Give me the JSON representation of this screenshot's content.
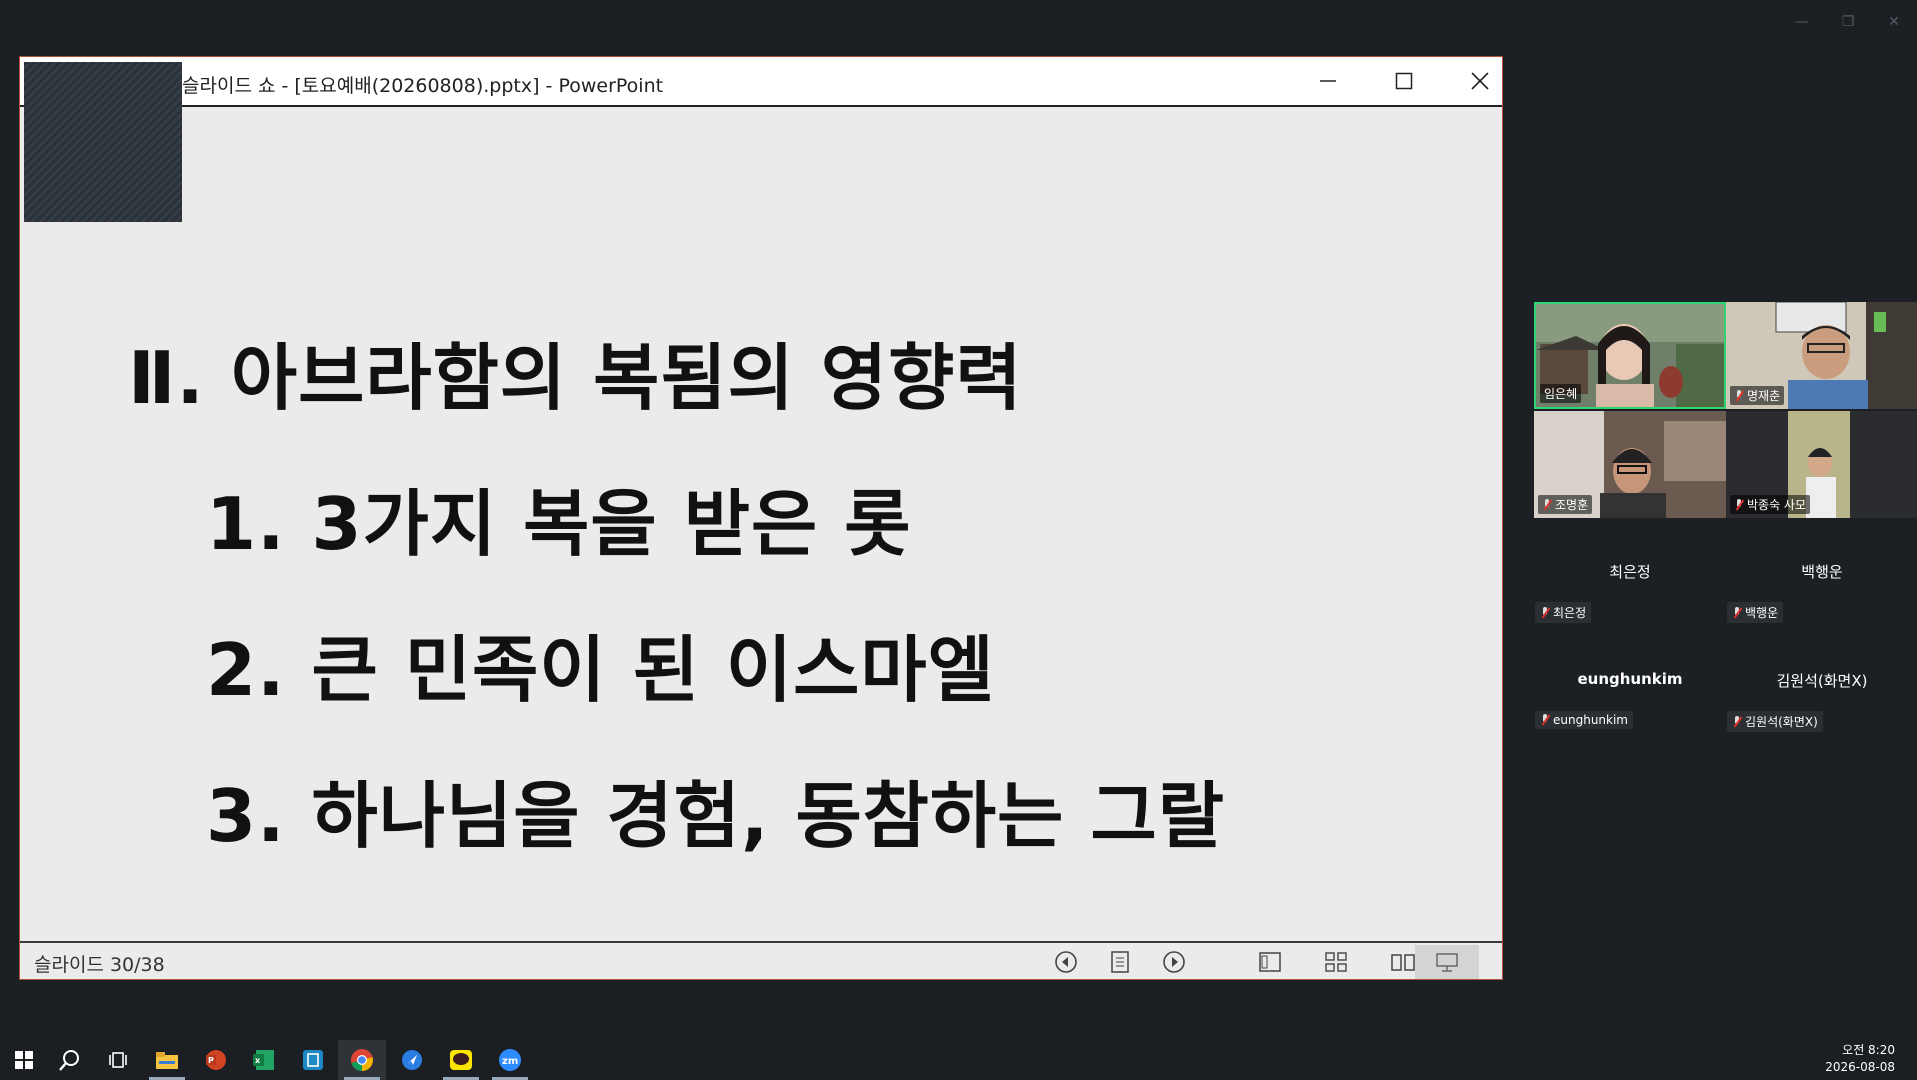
{
  "zoom_window": {
    "controls": [
      "minimize-icon",
      "restore-icon",
      "close-icon"
    ]
  },
  "ppt": {
    "title": "슬라이드 쇼 - [토요예배(20260808).pptx] - PowerPoint",
    "slide": {
      "heading": "Ⅱ. 아브라함의 복됨의 영향력",
      "items": [
        "1. 3가지 복을 받은 롯",
        "2. 큰 민족이 된 이스마엘",
        "3. 하나님을 경험, 동참하는 그랄"
      ]
    },
    "status": {
      "slide_counter": "슬라이드 30/38"
    }
  },
  "participants": {
    "video": [
      {
        "name": "임은혜",
        "muted": false,
        "active_speaker": true
      },
      {
        "name": "명재춘",
        "muted": true
      },
      {
        "name": "조명훈",
        "muted": true
      },
      {
        "name": "박종숙 사모",
        "muted": true
      }
    ],
    "no_video": [
      {
        "name": "최은정",
        "tag": "최은정"
      },
      {
        "name": "백행운",
        "tag": "백행운"
      },
      {
        "name": "eunghunkim",
        "tag": "eunghunkim"
      },
      {
        "name": "김원석(화면X)",
        "tag": "김원석(화면X)"
      }
    ]
  },
  "taskbar": {
    "icons": [
      "windows-start-icon",
      "search-icon",
      "task-view-icon",
      "file-explorer-icon",
      "powerpoint-icon",
      "excel-icon",
      "app-icon",
      "chrome-icon",
      "app-arrow-icon",
      "kakaotalk-icon",
      "zoom-icon"
    ],
    "time": "오전 8:20",
    "date": "2026-08-08"
  },
  "colors": {
    "active_speaker_border": "#2ed573",
    "ppt_border": "#b0533a",
    "mute_red": "#e0322c"
  }
}
